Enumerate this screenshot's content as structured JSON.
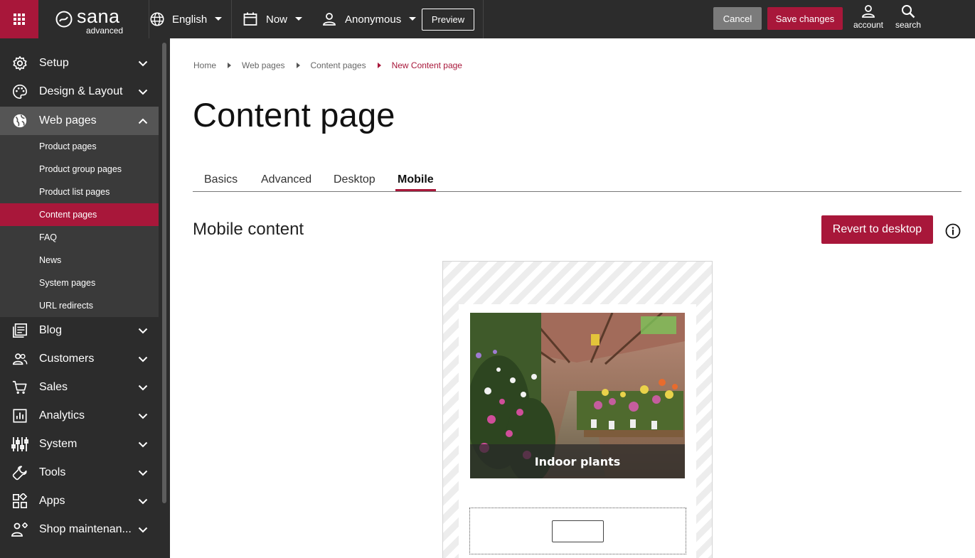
{
  "topbar": {
    "logo_text": "sana",
    "logo_subtext": "advanced",
    "language": "English",
    "date": "Now",
    "user": "Anonymous",
    "preview_label": "Preview",
    "cancel_label": "Cancel",
    "save_label": "Save changes",
    "account_label": "account",
    "search_label": "search"
  },
  "sidebar": {
    "items": [
      {
        "label": "Setup",
        "icon": "gear-icon"
      },
      {
        "label": "Design & Layout",
        "icon": "palette-icon"
      },
      {
        "label": "Web pages",
        "icon": "globe-icon"
      },
      {
        "label": "Blog",
        "icon": "blog-icon"
      },
      {
        "label": "Customers",
        "icon": "people-icon"
      },
      {
        "label": "Sales",
        "icon": "cart-icon"
      },
      {
        "label": "Analytics",
        "icon": "chart-icon"
      },
      {
        "label": "System",
        "icon": "sliders-icon"
      },
      {
        "label": "Tools",
        "icon": "wrench-icon"
      },
      {
        "label": "Apps",
        "icon": "apps-icon"
      },
      {
        "label": "Shop maintenan...",
        "icon": "maintenance-icon"
      }
    ],
    "web_pages_sub": [
      {
        "label": "Product pages"
      },
      {
        "label": "Product group pages"
      },
      {
        "label": "Product list pages"
      },
      {
        "label": "Content pages"
      },
      {
        "label": "FAQ"
      },
      {
        "label": "News"
      },
      {
        "label": "System pages"
      },
      {
        "label": "URL redirects"
      }
    ]
  },
  "breadcrumb": {
    "items": [
      "Home",
      "Web pages",
      "Content pages"
    ],
    "current": "New Content page"
  },
  "page": {
    "title": "Content page",
    "tabs": [
      "Basics",
      "Advanced",
      "Desktop",
      "Mobile"
    ],
    "active_tab": "Mobile",
    "section_title": "Mobile content",
    "revert_label": "Revert to desktop"
  },
  "preview": {
    "banner_caption": "Indoor plants"
  },
  "colors": {
    "accent": "#a8173a",
    "topbar": "#2c2c2c",
    "sidebar": "#2c2c2c",
    "sidebar_expanded": "#555555",
    "submenu": "#3a3a3a"
  }
}
